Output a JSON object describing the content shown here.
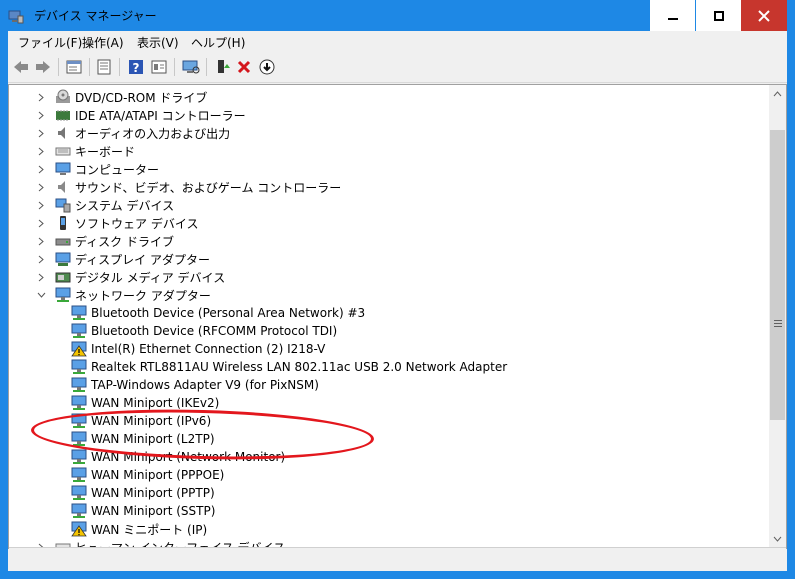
{
  "window": {
    "title": "デバイス マネージャー"
  },
  "menu": [
    "ファイル(F)",
    "操作(A)",
    "表示(V)",
    "ヘルプ(H)"
  ],
  "toolbar": {
    "icons": [
      "back-icon",
      "forward-icon",
      "properties-icon",
      "device-list-icon",
      "help-icon",
      "action-view-icon",
      "scan-hardware-icon",
      "enable-device-icon",
      "uninstall-icon",
      "update-driver-icon"
    ]
  },
  "tree": {
    "categories_top": [
      {
        "label": "DVD/CD-ROM ドライブ",
        "icon": "disc-drive-icon"
      },
      {
        "label": "IDE ATA/ATAPI コントローラー",
        "icon": "ide-controller-icon"
      },
      {
        "label": "オーディオの入力および出力",
        "icon": "speaker-icon"
      },
      {
        "label": "キーボード",
        "icon": "keyboard-icon"
      },
      {
        "label": "コンピューター",
        "icon": "computer-icon"
      },
      {
        "label": "サウンド、ビデオ、およびゲーム コントローラー",
        "icon": "sound-icon"
      },
      {
        "label": "システム デバイス",
        "icon": "system-device-icon"
      },
      {
        "label": "ソフトウェア デバイス",
        "icon": "software-device-icon"
      },
      {
        "label": "ディスク ドライブ",
        "icon": "disk-drive-icon"
      },
      {
        "label": "ディスプレイ アダプター",
        "icon": "display-adapter-icon"
      },
      {
        "label": "デジタル メディア デバイス",
        "icon": "media-device-icon"
      }
    ],
    "network_category": {
      "label": "ネットワーク アダプター",
      "icon": "network-adapter-icon"
    },
    "network_adapters": [
      {
        "label": "Bluetooth Device (Personal Area Network) #3",
        "warning": false
      },
      {
        "label": "Bluetooth Device (RFCOMM Protocol TDI)",
        "warning": false
      },
      {
        "label": "Intel(R) Ethernet Connection (2) I218-V",
        "warning": true
      },
      {
        "label": "Realtek RTL8811AU Wireless LAN 802.11ac USB 2.0 Network Adapter",
        "warning": false
      },
      {
        "label": "TAP-Windows Adapter V9 (for PixNSM)",
        "warning": false
      },
      {
        "label": "WAN Miniport (IKEv2)",
        "warning": false
      },
      {
        "label": "WAN Miniport (IPv6)",
        "warning": false
      },
      {
        "label": "WAN Miniport (L2TP)",
        "warning": false
      },
      {
        "label": "WAN Miniport (Network Monitor)",
        "warning": false
      },
      {
        "label": "WAN Miniport (PPPOE)",
        "warning": false
      },
      {
        "label": "WAN Miniport (PPTP)",
        "warning": false
      },
      {
        "label": "WAN Miniport (SSTP)",
        "warning": false
      },
      {
        "label": "WAN ミニポート (IP)",
        "warning": true
      }
    ],
    "category_bottom": {
      "label": "ヒューマン インターフェイス デバイス",
      "icon": "hid-icon"
    }
  },
  "colors": {
    "titlebar": "#1e88e5",
    "close_button": "#c7362d",
    "annotation_ellipse": "#e3171d",
    "warning": "#f5c400"
  }
}
